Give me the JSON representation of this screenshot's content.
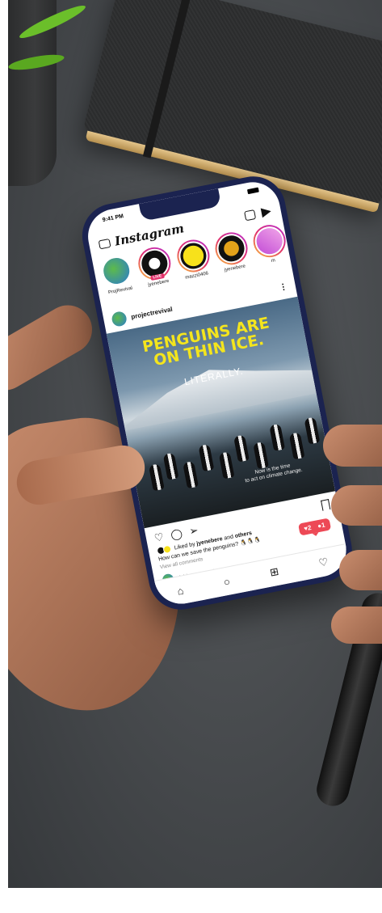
{
  "app": {
    "title": "Instagram",
    "status_time": "9:41 PM"
  },
  "stories": [
    {
      "name": "ProjRevival",
      "type": "own"
    },
    {
      "name": "jyenebere",
      "live_label": "LIVE"
    },
    {
      "name": "mazzi0406"
    },
    {
      "name": "jyenebere"
    },
    {
      "name": "m"
    }
  ],
  "post": {
    "user": "projectrevival",
    "headline_1": "PENGUINS ARE",
    "headline_2": "ON THIN ICE.",
    "sub_headline": "LITERALLY.",
    "overlay_1": "Now is the time",
    "overlay_2": "to act on climate change.",
    "liked_prefix": "Liked by",
    "liked_user": "jyenebere",
    "liked_and": "and",
    "liked_others": "others",
    "caption": "How can we save the penguins? 🐧🐧🐧",
    "view_comments": "View all comments",
    "comment_placeholder": "Add a comment..."
  },
  "notification": {
    "likes": "2",
    "comments": "1"
  },
  "colors": {
    "phone_frame": "#1b2350",
    "headline": "#f4e51d",
    "notif": "#ed4956"
  },
  "icons": [
    "camera-icon",
    "igtv-icon",
    "direct-message-icon",
    "heart-icon",
    "comment-icon",
    "share-icon",
    "bookmark-icon",
    "home-icon",
    "search-icon",
    "add-icon",
    "activity-icon"
  ]
}
